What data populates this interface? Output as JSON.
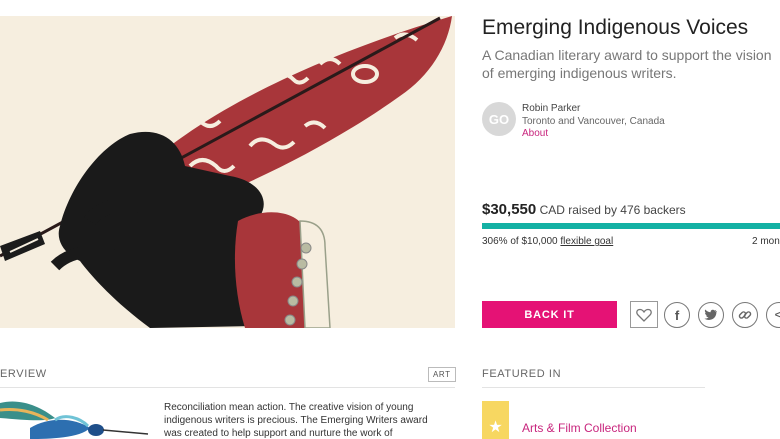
{
  "campaign": {
    "title": "Emerging Indigenous Voices",
    "subtitle": "A Canadian literary award to support the vision of emerging indigenous writers.",
    "image_icon": "quill-hand-illustration"
  },
  "owner": {
    "initials": "GO",
    "name": "Robin Parker",
    "location": "Toronto and Vancouver, Canada",
    "about_label": "About"
  },
  "funding": {
    "amount": "$30,550",
    "raised_text": "CAD raised by 476 backers",
    "percent_text": "306% of $10,000",
    "goal_type": "flexible goal",
    "time_left": "2 mon",
    "progress_fraction": 1.0,
    "progress_color": "#14b1a4"
  },
  "actions": {
    "back_label": "BACK IT",
    "back_color": "#e51275",
    "follow_icon": "heart-icon",
    "share_icons": [
      "facebook-icon",
      "twitter-icon",
      "link-icon",
      "embed-icon"
    ],
    "facebook_glyph": "f",
    "embed_glyph": "</"
  },
  "overview": {
    "label": "ERVIEW",
    "tag": "ART",
    "story": "Reconciliation mean action. The creative vision of young indigenous writers is precious. The Emerging Writers award was created  to help support and nurture the work of"
  },
  "featured": {
    "label": "FEATURED IN",
    "collection": "Arts & Film Collection",
    "badge_icon": "star-icon",
    "badge_glyph": "★",
    "badge_color": "#f7d761"
  },
  "colors": {
    "accent": "#c8257d",
    "feather": "#a8363a"
  }
}
